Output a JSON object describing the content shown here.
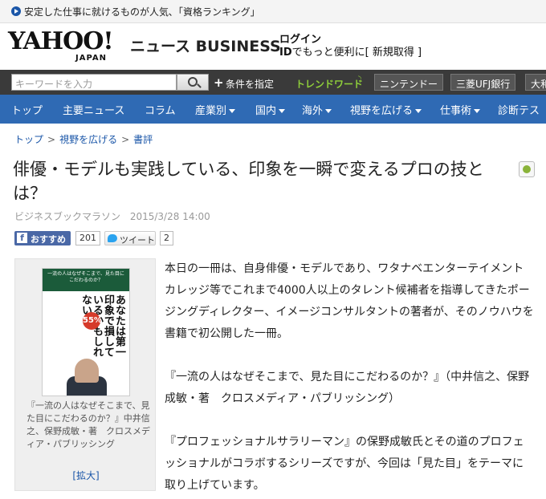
{
  "promo": {
    "text": "安定した仕事に就けるものが人気､「資格ランキング」"
  },
  "header": {
    "logo_main": "YAHOO!",
    "logo_sub": "JAPAN",
    "service_name": "ニュース BUSINESS",
    "login_label": "ログイン",
    "id_prefix": "ID",
    "id_text": "でもっと便利に[ 新規取得 ]"
  },
  "search": {
    "placeholder": "キーワードを入力",
    "condition_label": "条件を指定",
    "trend_label": "トレンドワード",
    "trend_words": [
      "ニンテンドー",
      "三菱UFJ銀行",
      "大和"
    ]
  },
  "nav": {
    "items": [
      {
        "label": "トップ",
        "dropdown": false
      },
      {
        "label": "主要ニュース",
        "dropdown": false
      },
      {
        "label": "コラム",
        "dropdown": false
      },
      {
        "label": "産業別",
        "dropdown": true
      },
      {
        "label": "国内",
        "dropdown": true
      },
      {
        "label": "海外",
        "dropdown": true
      },
      {
        "label": "視野を広げる",
        "dropdown": true
      },
      {
        "label": "仕事術",
        "dropdown": true
      },
      {
        "label": "診断テス",
        "dropdown": false
      }
    ]
  },
  "breadcrumb": {
    "items": [
      "トップ",
      "視野を広げる",
      "書評"
    ],
    "separator": ">"
  },
  "article": {
    "title": "俳優・モデルも実践している、印象を一瞬で変えるプロの技とは？",
    "source": "ビジネスブックマラソン",
    "datetime": "2015/3/28 14:00",
    "fb_label": "おすすめ",
    "fb_count": "201",
    "tweet_label": "ツイート",
    "tweet_count": "2",
    "paragraphs": [
      "本日の一冊は、自身俳優・モデルであり、ワタナベエンターテイメントカレッジ等でこれまで4000人以上のタレント候補者を指導してきたポージングディレクター、イメージコンサルタントの著者が、そのノウハウを書籍で初公開した一冊。",
      "『一流の人はなぜそこまで、見た目にこだわるのか？』（中井信之、保野成敏・著　クロスメディア・パブリッシング）",
      "『プロフェッショナルサラリーマン』の保野成敏氏とその道のプロフェッショナルがコラボするシリーズですが、今回は「見た目」をテーマに取り上げています。"
    ]
  },
  "sidebar": {
    "book_top": "一流の人はなぜそこまで、見た目にこだわるのか？",
    "book_big": "あなたは第一印象で損しているかもしれない",
    "book_badge": "55%",
    "caption": "『一流の人はなぜそこまで、見た目にこだわるのか？』中井信之、保野成敏・著　クロスメディア・パブリッシング",
    "zoom_label": "[拡大]"
  }
}
